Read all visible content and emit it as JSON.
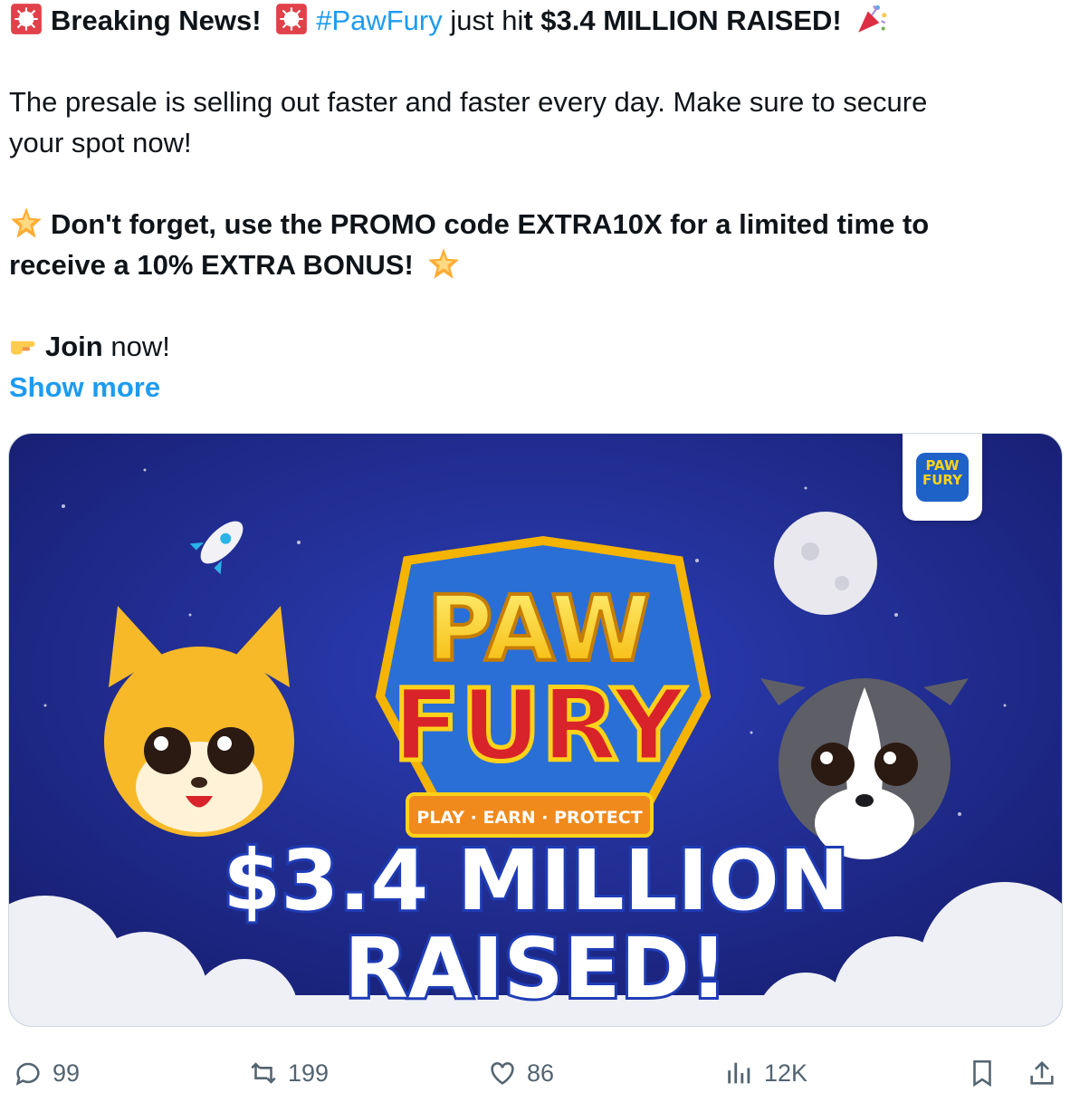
{
  "tweet": {
    "line1": {
      "emoji_alarm": "🚨",
      "breaking": "Breaking News!",
      "hashtag": "#PawFury",
      "just_hit_pre": "just hi",
      "just_hit_bold": "t $3.4 MILLION RAISED!",
      "party": "🎉"
    },
    "paragraph1": "The presale is selling out faster and faster every day. Make sure to secure",
    "paragraph1_cont": "your spot now!",
    "promo_line1": "Don't forget, use the PROMO code EXTRA10X for a limited time to",
    "promo_line2": "receive a 10% EXTRA BONUS!",
    "join_bold": "Join",
    "join_rest": " now!",
    "show_more": "Show more"
  },
  "media": {
    "logo_line1": "PAW",
    "logo_line2": "FURY",
    "tagline": "PLAY · EARN · PROTECT",
    "headline1": "$3.4 MILLION",
    "headline2": "RAISED!",
    "badge1": "PAW",
    "badge2": "FURY",
    "colors": {
      "sky": "#1f2a8f",
      "gold": "#ffd21a",
      "red": "#d8232a",
      "shield": "#2a6fd6"
    }
  },
  "actions": {
    "replies": "99",
    "reposts": "199",
    "likes": "86",
    "views": "12K"
  }
}
